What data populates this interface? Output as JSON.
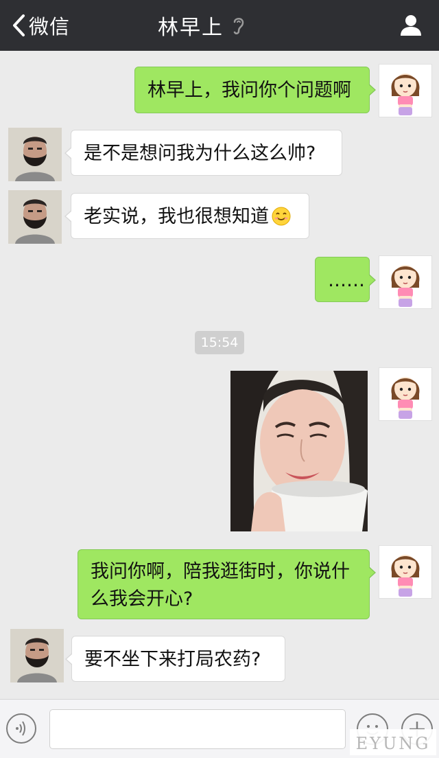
{
  "header": {
    "back_label": "微信",
    "title": "林早上"
  },
  "messages": [
    {
      "side": "right",
      "text": "林早上，我问你个问题啊"
    },
    {
      "side": "left",
      "text": "是不是想问我为什么这么帅?"
    },
    {
      "side": "left",
      "text": "老实说，我也很想知道",
      "emoji": "smile-emoji"
    },
    {
      "side": "right",
      "text": "……"
    },
    {
      "side": "right",
      "image": "woman-smiling-with-cup-photo"
    },
    {
      "side": "right",
      "text_line1": "我问你啊，陪我逛街时，你说什",
      "text_line2": "么我会开心?"
    },
    {
      "side": "left",
      "text": "要不坐下来打局农药?"
    }
  ],
  "timestamp": "15:54",
  "input": {
    "value": ""
  },
  "watermark": "EYUNG",
  "colors": {
    "header_bg": "#2e2f33",
    "chat_bg": "#ebebeb",
    "sent_bubble": "#9fe761",
    "received_bubble": "#ffffff"
  }
}
